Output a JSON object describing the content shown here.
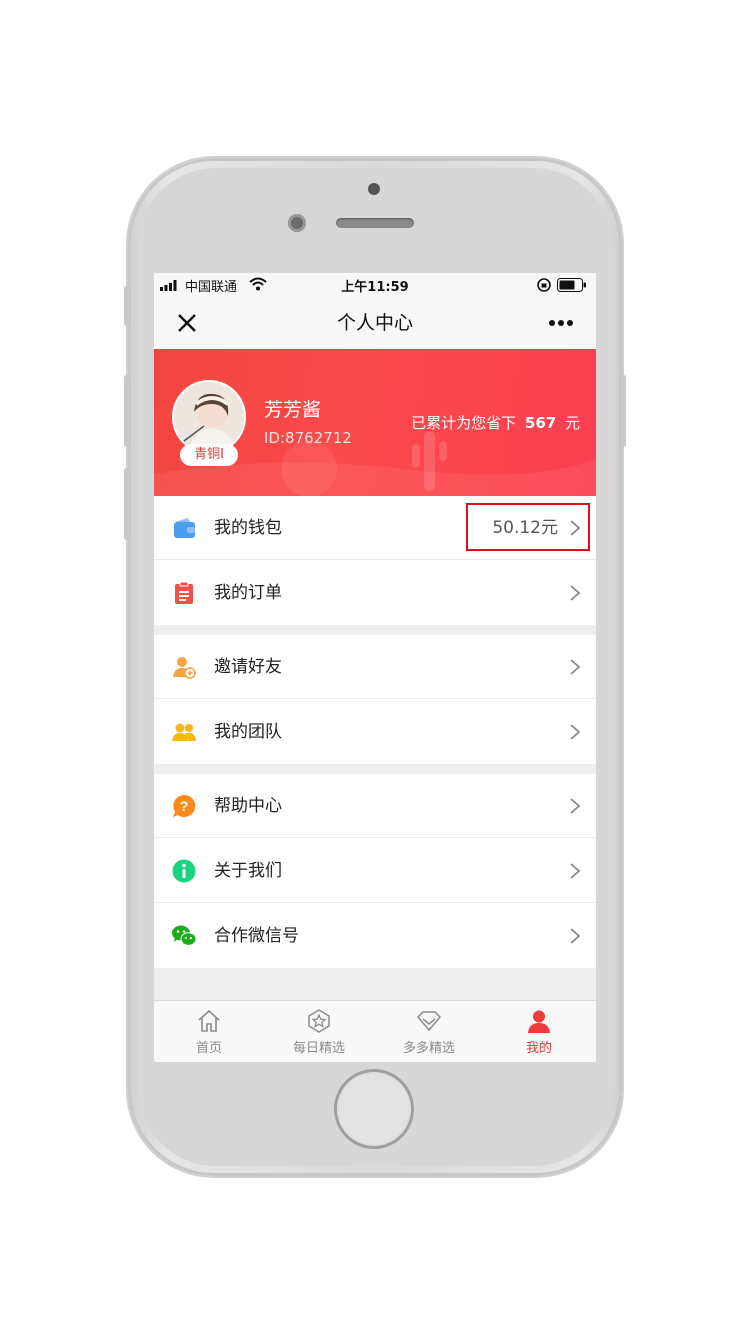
{
  "status": {
    "carrier": "中国联通",
    "time": "上午11:59"
  },
  "nav": {
    "title": "个人中心"
  },
  "profile": {
    "name": "芳芳酱",
    "id_text": "ID:8762712",
    "level_badge": "青铜I",
    "saved_text": "已累计为您省下",
    "saved_amount": "567",
    "saved_unit": "元"
  },
  "menu": {
    "wallet": {
      "label": "我的钱包",
      "value": "50.12元"
    },
    "orders": {
      "label": "我的订单"
    },
    "invite": {
      "label": "邀请好友"
    },
    "team": {
      "label": "我的团队"
    },
    "help": {
      "label": "帮助中心"
    },
    "about": {
      "label": "关于我们"
    },
    "wechat": {
      "label": "合作微信号"
    }
  },
  "tabs": [
    {
      "label": "首页",
      "icon": "home-icon"
    },
    {
      "label": "每日精选",
      "icon": "star-badge-icon"
    },
    {
      "label": "多多精选",
      "icon": "diamond-icon"
    },
    {
      "label": "我的",
      "icon": "person-icon"
    }
  ],
  "colors": {
    "accent": "#fb4a4a",
    "highlight_box": "#d8111a",
    "active_tab": "#e43a3a"
  }
}
